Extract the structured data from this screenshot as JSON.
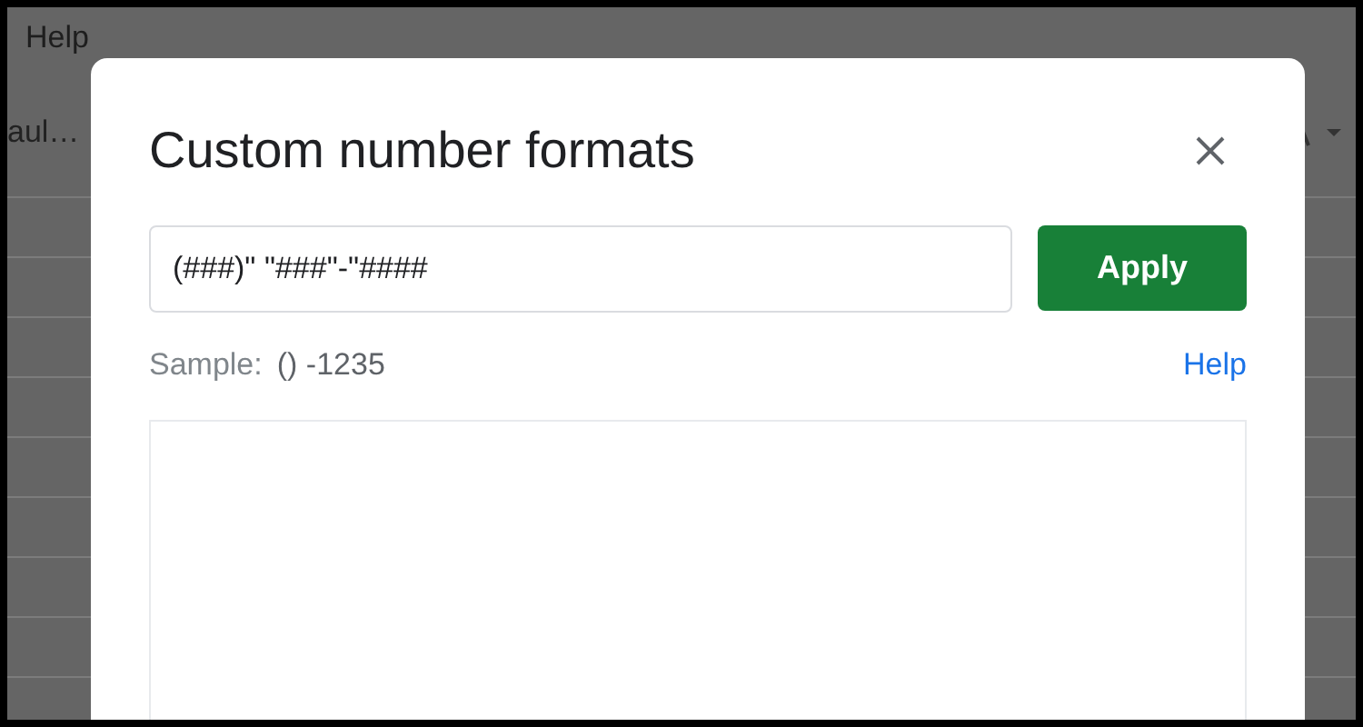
{
  "menu": [
    {
      "label": "Help"
    }
  ],
  "toolbar": {
    "font_name": "aul…"
  },
  "dialog": {
    "title": "Custom number formats",
    "format_field": {
      "value": "(###)\" \"###\"-\"####"
    },
    "apply_button": "Apply",
    "sample_label": "Sample:",
    "sample_value": "() -1235",
    "help_link": "Help"
  }
}
